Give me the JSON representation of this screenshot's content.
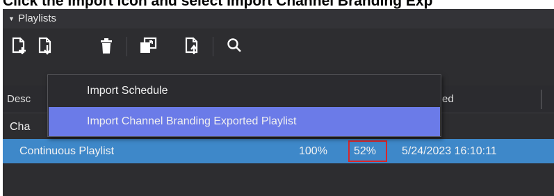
{
  "instruction": "Click the Import icon and select Import Channel Branding Exp",
  "panel": {
    "title": "Playlists"
  },
  "toolbar": {
    "buttons": [
      {
        "icon": "new-playlist-icon"
      },
      {
        "icon": "import-icon"
      },
      {
        "icon": "delete-icon"
      },
      {
        "icon": "copy-to-icon"
      },
      {
        "icon": "export-icon"
      },
      {
        "icon": "search-icon"
      }
    ]
  },
  "table": {
    "columns": [
      "Desc",
      "ed"
    ],
    "rows": [
      {
        "name": "Cha"
      },
      {
        "name": "Continuous Playlist",
        "col2": "100%",
        "col3": "52%",
        "date": "5/24/2023 16:10:11",
        "selected": true
      }
    ]
  },
  "import_menu": {
    "items": [
      "Import Schedule",
      "Import Channel Branding Exported Playlist"
    ],
    "highlighted_index": 1
  },
  "colors": {
    "panel_bg": "#2d2d30",
    "selection": "#3e88c9",
    "menu_highlight": "#6b7be8",
    "annotation_box": "#d9262a"
  }
}
